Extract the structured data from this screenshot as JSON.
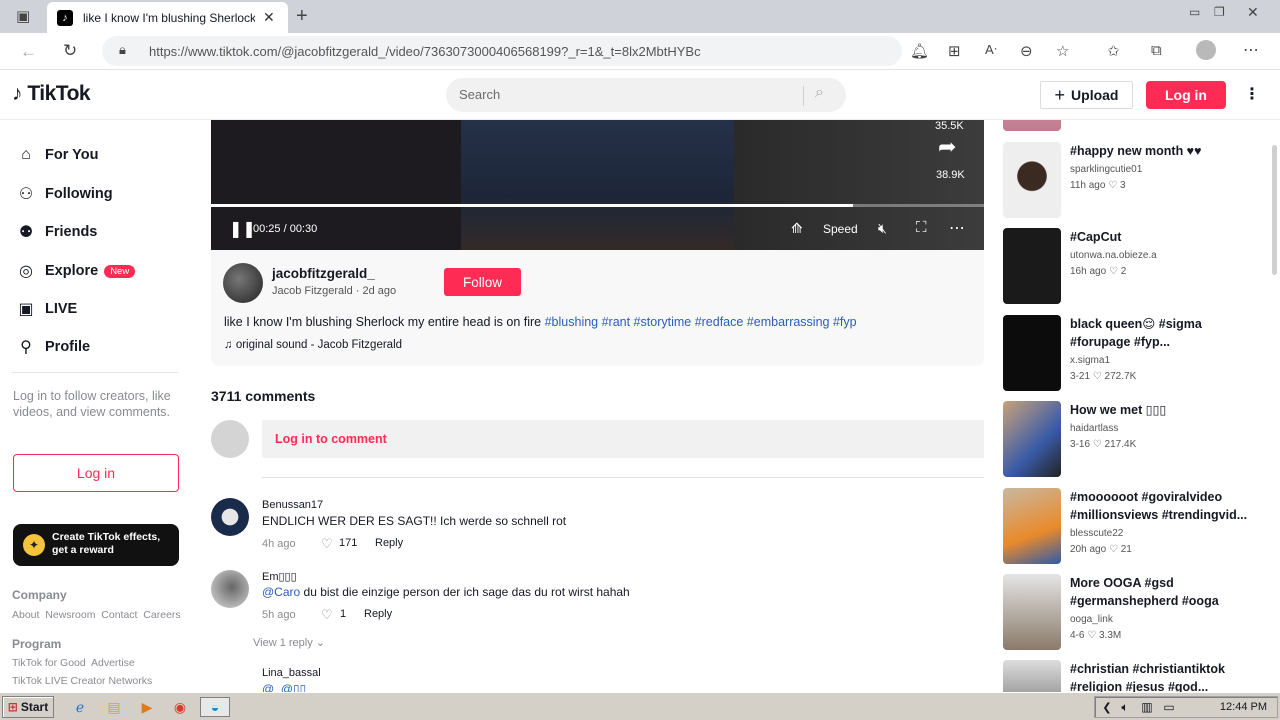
{
  "browser": {
    "tab_title": "like I know I'm blushing Sherlock",
    "url": "https://www.tiktok.com/@jacobfitzgerald_/video/7363073000406568199?_r=1&_t=8lx2MbtHYBc"
  },
  "header": {
    "logo": "TikTok",
    "search_placeholder": "Search",
    "upload_label": "Upload",
    "login_label": "Log in"
  },
  "sidebar": {
    "items": [
      {
        "label": "For You",
        "icon": "home-icon"
      },
      {
        "label": "Following",
        "icon": "following-icon"
      },
      {
        "label": "Friends",
        "icon": "friends-icon"
      },
      {
        "label": "Explore",
        "icon": "explore-icon",
        "badge": "New"
      },
      {
        "label": "LIVE",
        "icon": "live-icon"
      },
      {
        "label": "Profile",
        "icon": "profile-icon"
      }
    ],
    "login_prompt": "Log in to follow creators, like videos, and view comments.",
    "login_button": "Log in",
    "effects_banner": "Create TikTok effects, get a reward",
    "company_heading": "Company",
    "company_links": "About  Newsroom  Contact  Careers",
    "program_heading": "Program",
    "program_links_1": "TikTok for Good  Advertise",
    "program_links_2": "TikTok LIVE Creator Networks"
  },
  "video": {
    "share_count_top": "35.5K",
    "share_count": "38.9K",
    "time": "00:25 / 00:30",
    "progress": 0.83,
    "speed_label": "Speed"
  },
  "post": {
    "username": "jacobfitzgerald_",
    "display_name": "Jacob Fitzgerald",
    "age": "2d ago",
    "follow_label": "Follow",
    "caption": "like I know I'm blushing Sherlock my entire head is on fire",
    "hashtags": "#blushing #rant #storytime #redface #embarrassing #fyp",
    "sound": "original sound - Jacob Fitzgerald"
  },
  "comments": {
    "count_label": "3711 comments",
    "login_to_comment": "Log in to comment",
    "items": [
      {
        "user": "Benussan17",
        "text": "ENDLICH WER DER ES SAGT!! Ich werde so schnell rot",
        "time": "4h ago",
        "likes": "171",
        "reply": "Reply"
      },
      {
        "user": "Em▯▯▯",
        "mention": "@Caro",
        "text": " du bist die einzige person der ich sage das du rot wirst hahah",
        "time": "5h ago",
        "likes": "1",
        "reply": "Reply",
        "view_replies": "View 1 reply"
      },
      {
        "user": "Lina_bassal",
        "mention": "@_@▯▯"
      }
    ]
  },
  "recommended": [
    {
      "title": "#happy new month ♥♥",
      "user": "sparklingcutie01",
      "time": "11h ago",
      "likes": "3"
    },
    {
      "title": "#CapCut",
      "user": "utonwa.na.obieze.a",
      "time": "16h ago",
      "likes": "2"
    },
    {
      "title": "black queen😌 #sigma #forupage #fyp...",
      "user": "x.sigma1",
      "time": "3-21",
      "likes": "272.7K"
    },
    {
      "title": "How we met ▯▯▯",
      "user": "haidartlass",
      "time": "3-16",
      "likes": "217.4K"
    },
    {
      "title": "#moooooot #goviralvideo #millionsviews #trendingvid...",
      "user": "blesscute22",
      "time": "20h ago",
      "likes": "21"
    },
    {
      "title": "More OOGA #gsd #germanshepherd #ooga",
      "user": "ooga_link",
      "time": "4-6",
      "likes": "3.3M"
    },
    {
      "title": "#christian #christiantiktok #religion #jesus #god..."
    }
  ],
  "taskbar": {
    "start_label": "Start",
    "clock": "12:44 PM"
  }
}
